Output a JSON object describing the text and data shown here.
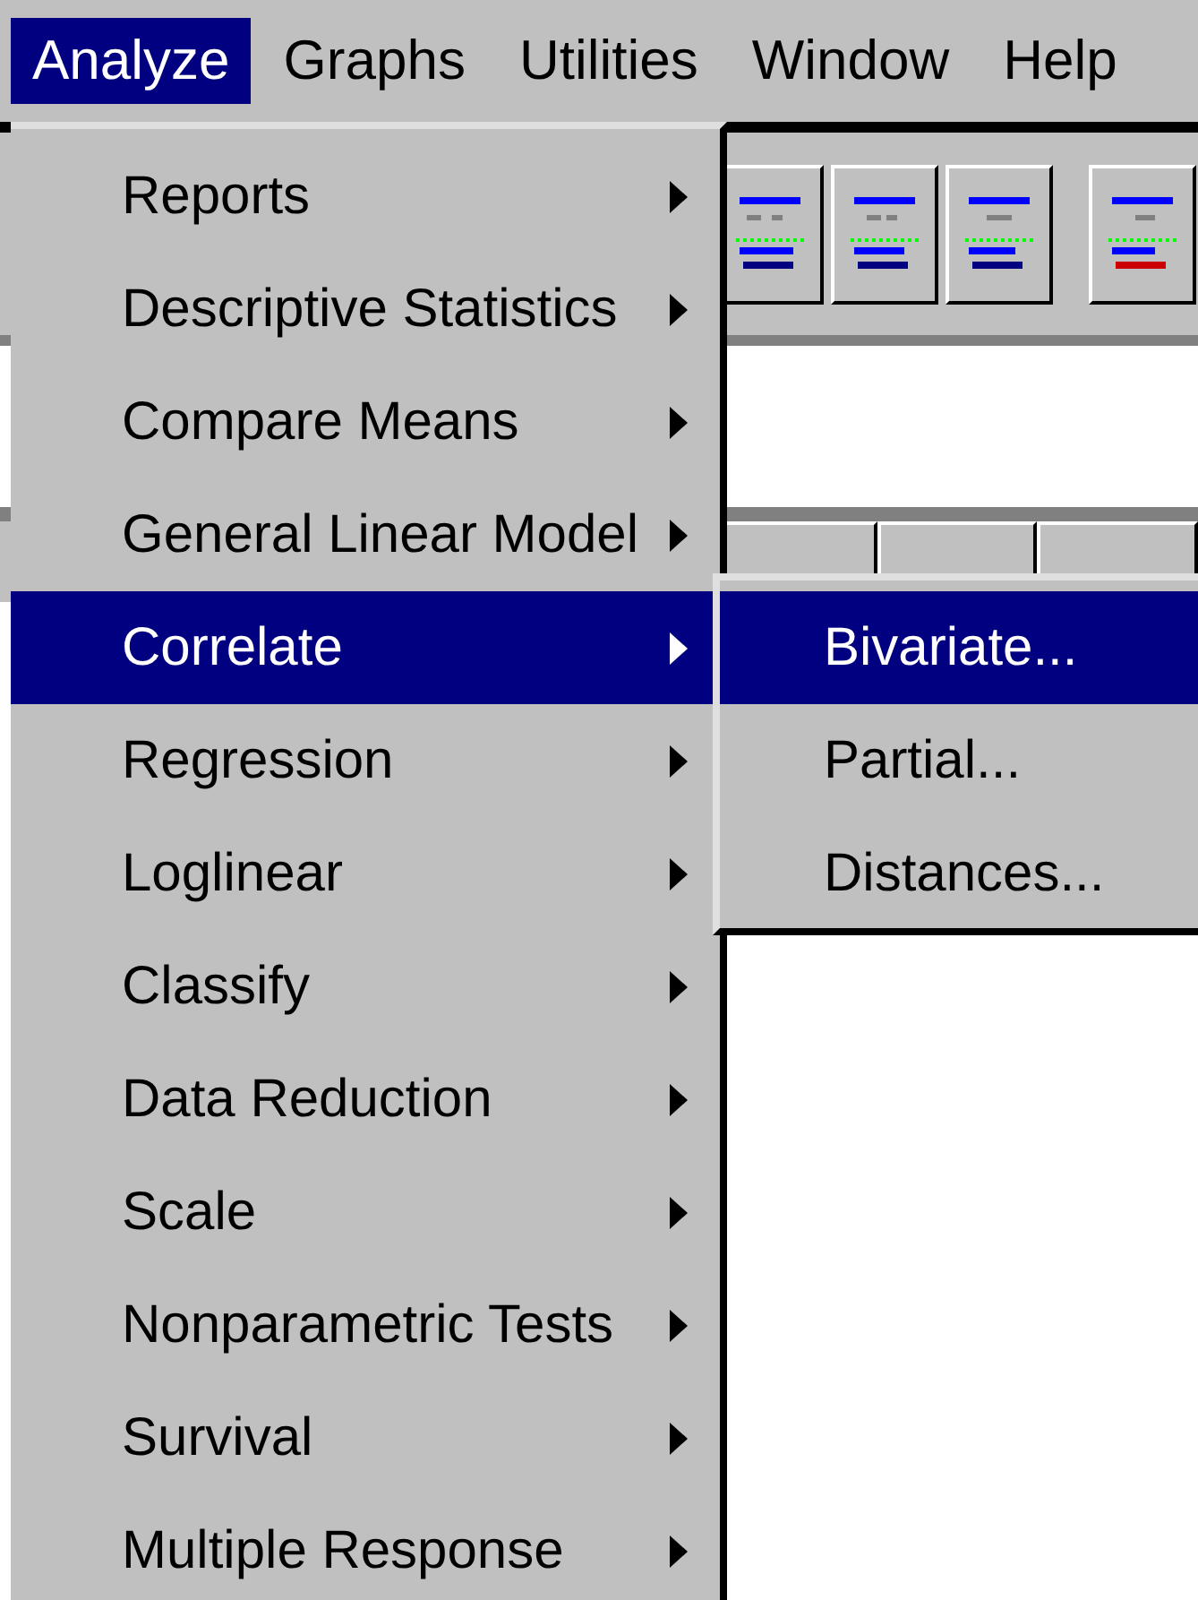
{
  "menu_bar": [
    {
      "label": "Analyze",
      "selected": true
    },
    {
      "label": "Graphs",
      "selected": false
    },
    {
      "label": "Utilities",
      "selected": false
    },
    {
      "label": "Window",
      "selected": false
    },
    {
      "label": "Help",
      "selected": false
    }
  ],
  "analyze_menu": [
    {
      "label": "Reports",
      "selected": false
    },
    {
      "label": "Descriptive Statistics",
      "selected": false
    },
    {
      "label": "Compare Means",
      "selected": false
    },
    {
      "label": "General Linear Model",
      "selected": false
    },
    {
      "label": "Correlate",
      "selected": true
    },
    {
      "label": "Regression",
      "selected": false
    },
    {
      "label": "Loglinear",
      "selected": false
    },
    {
      "label": "Classify",
      "selected": false
    },
    {
      "label": "Data Reduction",
      "selected": false
    },
    {
      "label": "Scale",
      "selected": false
    },
    {
      "label": "Nonparametric Tests",
      "selected": false
    },
    {
      "label": "Survival",
      "selected": false
    },
    {
      "label": "Multiple Response",
      "selected": false
    }
  ],
  "correlate_submenu": [
    {
      "label": "Bivariate...",
      "selected": true
    },
    {
      "label": "Partial...",
      "selected": false
    },
    {
      "label": "Distances...",
      "selected": false
    }
  ]
}
